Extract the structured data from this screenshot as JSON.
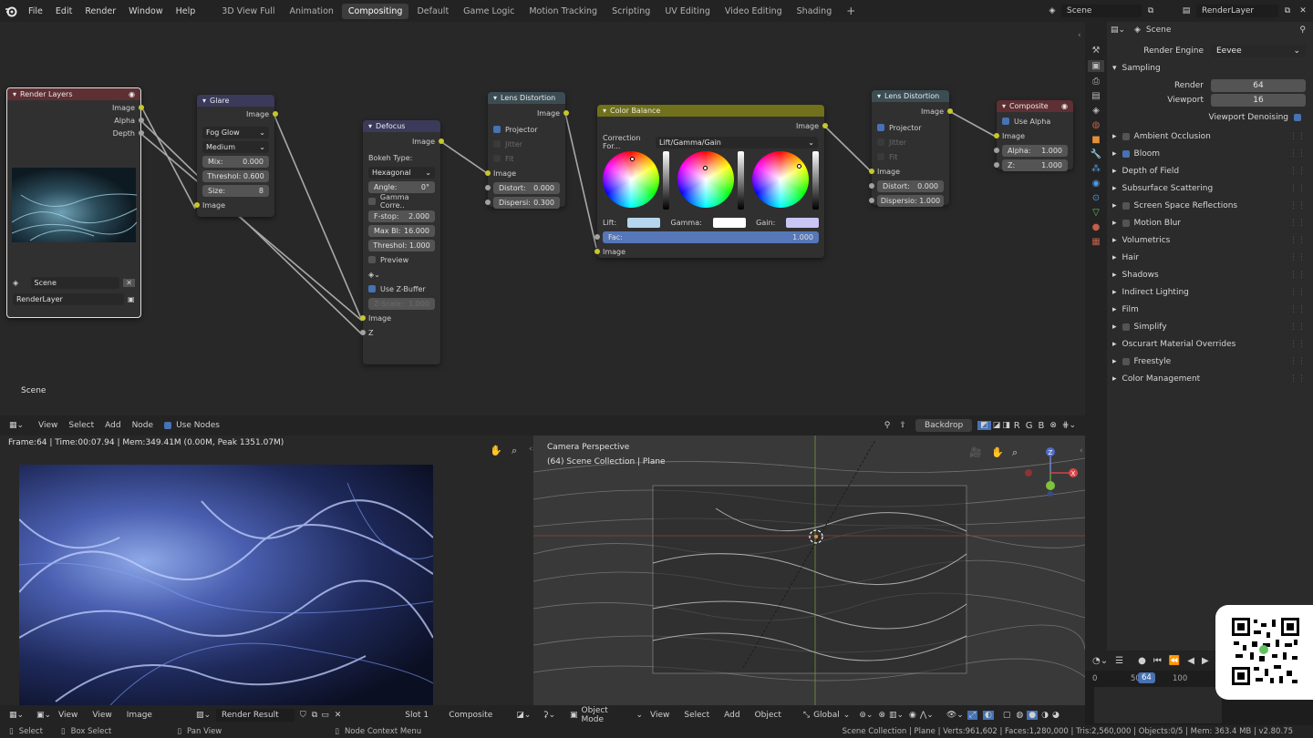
{
  "topbar": {
    "menus": [
      "File",
      "Edit",
      "Render",
      "Window",
      "Help"
    ],
    "workspaces": [
      "3D View Full",
      "Animation",
      "Compositing",
      "Default",
      "Game Logic",
      "Motion Tracking",
      "Scripting",
      "UV Editing",
      "Video Editing",
      "Shading"
    ],
    "active_workspace": "Compositing",
    "add_tab": "+",
    "scene": "Scene",
    "view_layer": "RenderLayer"
  },
  "nodes": {
    "render_layers": {
      "title": "Render Layers",
      "outputs": [
        "Image",
        "Alpha",
        "Depth"
      ],
      "scene": "Scene",
      "layer": "RenderLayer"
    },
    "glare": {
      "title": "Glare",
      "out": "Image",
      "type": "Fog Glow",
      "quality": "Medium",
      "mix": "Mix:",
      "mix_val": "0.000",
      "threshold": "Threshol: 0.600",
      "size": "Size:",
      "size_val": "8",
      "in": "Image"
    },
    "defocus": {
      "title": "Defocus",
      "out": "Image",
      "bokeh_label": "Bokeh Type:",
      "bokeh": "Hexagonal",
      "angle": "Angle:",
      "angle_val": "0°",
      "gamma": "Gamma Corre..",
      "fstop": "F-stop:",
      "fstop_val": "2.000",
      "maxblur": "Max Bl:",
      "maxblur_val": "16.000",
      "threshold": "Threshol: 1.000",
      "preview": "Preview",
      "zbuffer": "Use Z-Buffer",
      "zscale": "Z-Scale:",
      "zscale_val": "1.000",
      "in_image": "Image",
      "in_z": "Z"
    },
    "lens1": {
      "title": "Lens Distortion",
      "out": "Image",
      "projector": "Projector",
      "jitter": "Jitter",
      "fit": "Fit",
      "in": "Image",
      "distort": "Distort:",
      "distort_val": "0.000",
      "dispersion": "Dispersi:",
      "dispersion_val": "0.300"
    },
    "color_balance": {
      "title": "Color Balance",
      "out": "Image",
      "correction_label": "Correction For...",
      "correction": "Lift/Gamma/Gain",
      "lift": "Lift:",
      "gamma": "Gamma:",
      "gain": "Gain:",
      "fac": "Fac:",
      "fac_val": "1.000",
      "in": "Image"
    },
    "lens2": {
      "title": "Lens Distortion",
      "out": "Image",
      "projector": "Projector",
      "jitter": "Jitter",
      "fit": "Fit",
      "in": "Image",
      "distort": "Distort:",
      "distort_val": "0.000",
      "dispersion": "Dispersio: 1.000"
    },
    "composite": {
      "title": "Composite",
      "use_alpha": "Use Alpha",
      "in": "Image",
      "alpha": "Alpha:",
      "alpha_val": "1.000",
      "z": "Z:",
      "z_val": "1.000"
    }
  },
  "node_editor": {
    "scene_label": "Scene",
    "menus": [
      "View",
      "Select",
      "Add",
      "Node"
    ],
    "use_nodes": "Use Nodes",
    "backdrop": "Backdrop",
    "channels": [
      "R",
      "G",
      "B"
    ]
  },
  "properties": {
    "scene": "Scene",
    "render_engine_label": "Render Engine",
    "render_engine": "Eevee",
    "sampling": "Sampling",
    "render_label": "Render",
    "render_val": "64",
    "viewport_label": "Viewport",
    "viewport_val": "16",
    "viewport_denoising": "Viewport Denoising",
    "panels": [
      {
        "label": "Ambient Occlusion",
        "check": true,
        "checked": false
      },
      {
        "label": "Bloom",
        "check": true,
        "checked": true
      },
      {
        "label": "Depth of Field",
        "check": false
      },
      {
        "label": "Subsurface Scattering",
        "check": false
      },
      {
        "label": "Screen Space Reflections",
        "check": true,
        "checked": false
      },
      {
        "label": "Motion Blur",
        "check": true,
        "checked": false
      },
      {
        "label": "Volumetrics",
        "check": false
      },
      {
        "label": "Hair",
        "check": false
      },
      {
        "label": "Shadows",
        "check": false
      },
      {
        "label": "Indirect Lighting",
        "check": false
      },
      {
        "label": "Film",
        "check": false
      },
      {
        "label": "Simplify",
        "check": true,
        "checked": false
      },
      {
        "label": "Oscurart Material Overrides",
        "check": false
      },
      {
        "label": "Freestyle",
        "check": true,
        "checked": false
      },
      {
        "label": "Color Management",
        "check": false
      }
    ]
  },
  "image_editor": {
    "info": "Frame:64 | Time:00:07.94 | Mem:349.41M (0.00M, Peak 1351.07M)",
    "menus": [
      "View",
      "View",
      "Image"
    ],
    "image_name": "Render Result",
    "slot": "Slot 1",
    "pass": "Composite"
  },
  "viewport": {
    "title": "Camera Perspective",
    "collection": "(64) Scene Collection | Plane",
    "mode": "Object Mode",
    "menus": [
      "View",
      "Select",
      "Add",
      "Object"
    ],
    "orientation": "Global"
  },
  "timeline": {
    "frame": "64",
    "ticks": [
      "0",
      "50",
      "100"
    ]
  },
  "statusbar": {
    "select": "Select",
    "box_select": "Box Select",
    "pan_view": "Pan View",
    "context_menu": "Node Context Menu",
    "stats": "Scene Collection | Plane | Verts:961,602 | Faces:1,280,000 | Tris:2,560,000 | Objects:0/5 | Mem: 363.4 MB | v2.80.75"
  },
  "colors": {
    "accent": "#4772b3",
    "input_header": "#5e2f33",
    "color_header": "#70711a",
    "socket_color": "#c7c729"
  }
}
